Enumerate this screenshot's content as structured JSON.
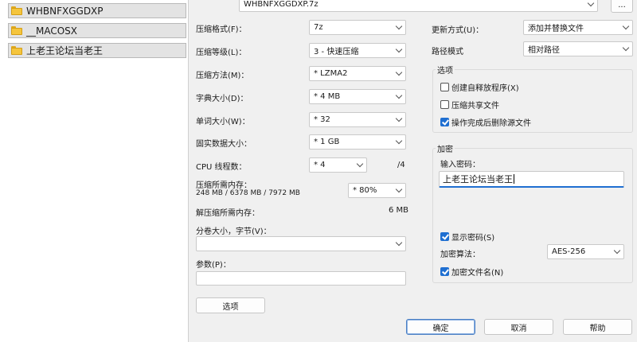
{
  "file_list": {
    "items": [
      {
        "name": "WHBNFXGGDXP"
      },
      {
        "name": "__MACOSX"
      },
      {
        "name": "上老王论坛当老王"
      }
    ]
  },
  "dialog": {
    "archive_path": "WHBNFXGGDXP.7z",
    "browse_label": "...",
    "left": {
      "format_label": "压缩格式(F)：",
      "format_value": "7z",
      "level_label": "压缩等级(L)：",
      "level_value": "3 - 快速压缩",
      "method_label": "压缩方法(M)：",
      "method_value": "* LZMA2",
      "dict_label": "字典大小(D)：",
      "dict_value": "* 4 MB",
      "word_label": "单词大小(W)：",
      "word_value": "* 32",
      "solid_label": "固实数据大小：",
      "solid_value": "* 1 GB",
      "cpu_label": "CPU 线程数：",
      "cpu_value": "* 4",
      "cpu_total": "/4",
      "mem_label": "压缩所需内存：",
      "mem_detail": "248 MB / 6378 MB / 7972 MB",
      "mem_value": "* 80%",
      "decomp_label": "解压缩所需内存：",
      "decomp_value": "6 MB",
      "split_label": "分卷大小，字节(V)：",
      "split_value": "",
      "params_label": "参数(P)：",
      "params_value": "",
      "options_button": "选项"
    },
    "right": {
      "update_label": "更新方式(U)：",
      "update_value": "添加并替换文件",
      "path_label": "路径模式",
      "path_value": "相对路径",
      "options_group": "选项",
      "opt_sfx": "创建自释放程序(X)",
      "opt_shared": "压缩共享文件",
      "opt_delete": "操作完成后删除源文件",
      "opt_sfx_checked": false,
      "opt_shared_checked": false,
      "opt_delete_checked": true,
      "encrypt_group": "加密",
      "password_label": "输入密码：",
      "password_value": "上老王论坛当老王",
      "show_password": "显示密码(S)",
      "show_password_checked": true,
      "enc_method_label": "加密算法：",
      "enc_method_value": "AES-256",
      "encrypt_names": "加密文件名(N)",
      "encrypt_names_checked": true
    },
    "buttons": {
      "ok": "确定",
      "cancel": "取消",
      "help": "帮助"
    }
  }
}
